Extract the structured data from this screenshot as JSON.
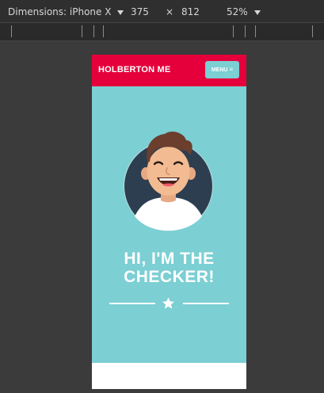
{
  "devtools": {
    "dimensions_label": "Dimensions: iPhone X",
    "width": "375",
    "times": "×",
    "height": "812",
    "zoom": "52%"
  },
  "site": {
    "brand": "HOLBERTON ME",
    "menu_label": "MENU",
    "menu_icon": "≡",
    "headline_line1": "HI, I'M THE",
    "headline_line2": "CHECKER!"
  },
  "colors": {
    "header": "#e5003c",
    "background": "#7ccfd3",
    "avatar_circle": "#2c3e50",
    "bottom": "#ffffff"
  },
  "icons": {
    "menu": "hamburger-icon",
    "divider": "star-icon",
    "avatar": "avatar-illustration"
  }
}
